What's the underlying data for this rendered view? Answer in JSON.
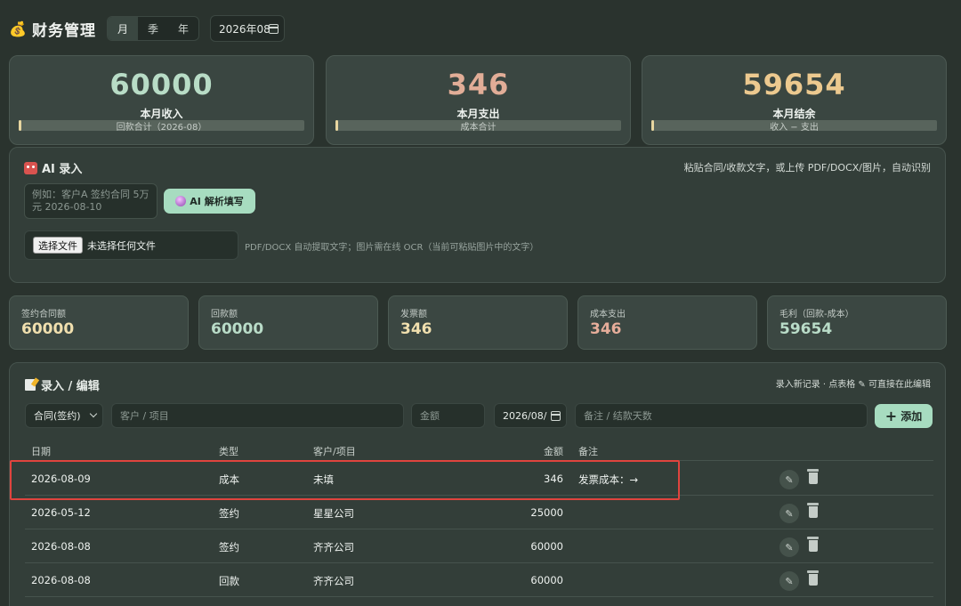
{
  "header": {
    "title": "财务管理",
    "period_tabs": [
      "月",
      "季",
      "年"
    ],
    "active_tab": "月",
    "date_value": "2026年08",
    "icons": {
      "logo": "money-bag-icon",
      "calendar": "calendar-icon"
    }
  },
  "kpis": [
    {
      "value": "60000",
      "label": "本月收入",
      "sub": "回款合计（2026-08）",
      "color": "#b8dcc6",
      "bar_fill": 0.01
    },
    {
      "value": "346",
      "label": "本月支出",
      "sub": "成本合计",
      "color": "#e1ad97",
      "bar_fill": 0.01
    },
    {
      "value": "59654",
      "label": "本月结余",
      "sub": "收入 − 支出",
      "color": "#ecc98f",
      "bar_fill": 0.01
    }
  ],
  "ai_panel": {
    "title": "AI 录入",
    "hint": "粘贴合同/收款文字，或上传 PDF/DOCX/图片，自动识别",
    "textarea_placeholder": "例如：客户A 签约合同 5万元 2026-08-10",
    "parse_button": "AI 解析填写",
    "file_button": "选择文件",
    "file_status": "未选择任何文件",
    "file_hint": "PDF/DOCX 自动提取文字；图片需在线 OCR（当前可粘贴图片中的文字）"
  },
  "stats": [
    {
      "label": "签约合同额",
      "value": "60000",
      "color": "#f0dfae"
    },
    {
      "label": "回款额",
      "value": "60000",
      "color": "#b9dcc8"
    },
    {
      "label": "发票额",
      "value": "346",
      "color": "#f0dfae"
    },
    {
      "label": "成本支出",
      "value": "346",
      "color": "#e6ad9a"
    },
    {
      "label": "毛利（回款-成本）",
      "value": "59654",
      "color": "#b9dcc8"
    }
  ],
  "entry": {
    "title": "录入 / 编辑",
    "hint": "录入新记录 · 点表格 ✎ 可直接在此编辑",
    "type_select": "合同(签约)",
    "client_placeholder": "客户 / 项目",
    "amount_placeholder": "金额",
    "date_value": "2026/08/",
    "note_placeholder": "备注 / 结款天数",
    "add_button": "添加"
  },
  "table": {
    "headers": {
      "date": "日期",
      "type": "类型",
      "client": "客户/项目",
      "amount": "金额",
      "note": "备注"
    },
    "rows": [
      {
        "date": "2026-08-09",
        "type": "成本",
        "client": "未填",
        "amount": "346",
        "note": "发票成本：→"
      },
      {
        "date": "2026-05-12",
        "type": "签约",
        "client": "星星公司",
        "amount": "25000",
        "note": ""
      },
      {
        "date": "2026-08-08",
        "type": "签约",
        "client": "齐齐公司",
        "amount": "60000",
        "note": ""
      },
      {
        "date": "2026-08-08",
        "type": "回款",
        "client": "齐齐公司",
        "amount": "60000",
        "note": ""
      }
    ],
    "edit_glyph": "✎"
  }
}
